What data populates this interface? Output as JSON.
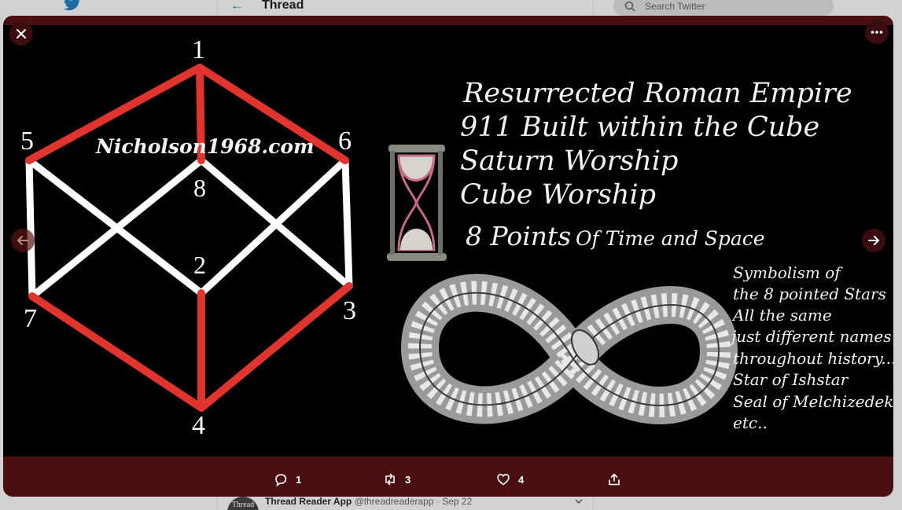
{
  "background": {
    "header_title": "Thread",
    "search_placeholder": "Search Twitter",
    "tweet": {
      "avatar_text": "Thread",
      "author_name": "Thread Reader App",
      "author_handle": "@threadreaderapp",
      "separator": "·",
      "date": "Sep 22"
    }
  },
  "image": {
    "watermark": "Nicholson1968.com",
    "numbers": [
      "1",
      "2",
      "3",
      "4",
      "5",
      "6",
      "7",
      "8"
    ],
    "headline_lines": [
      "Resurrected Roman Empire",
      "911 Built within the Cube",
      "Saturn Worship",
      "Cube Worship"
    ],
    "points_line_big": "8 Points",
    "points_line_small": "Of Time and Space",
    "symbolism_lines": [
      "Symbolism of",
      "the 8 pointed Stars",
      "All the same",
      "just different names",
      "throughout history...",
      "Star of Ishstar",
      "Seal of Melchizedek",
      "etc.."
    ]
  },
  "actions": {
    "reply_count": "1",
    "retweet_count": "3",
    "like_count": "4"
  },
  "colors": {
    "modal_bg": "#4a0f10",
    "red_line": "#e0352e",
    "white_line": "#ffffff"
  }
}
